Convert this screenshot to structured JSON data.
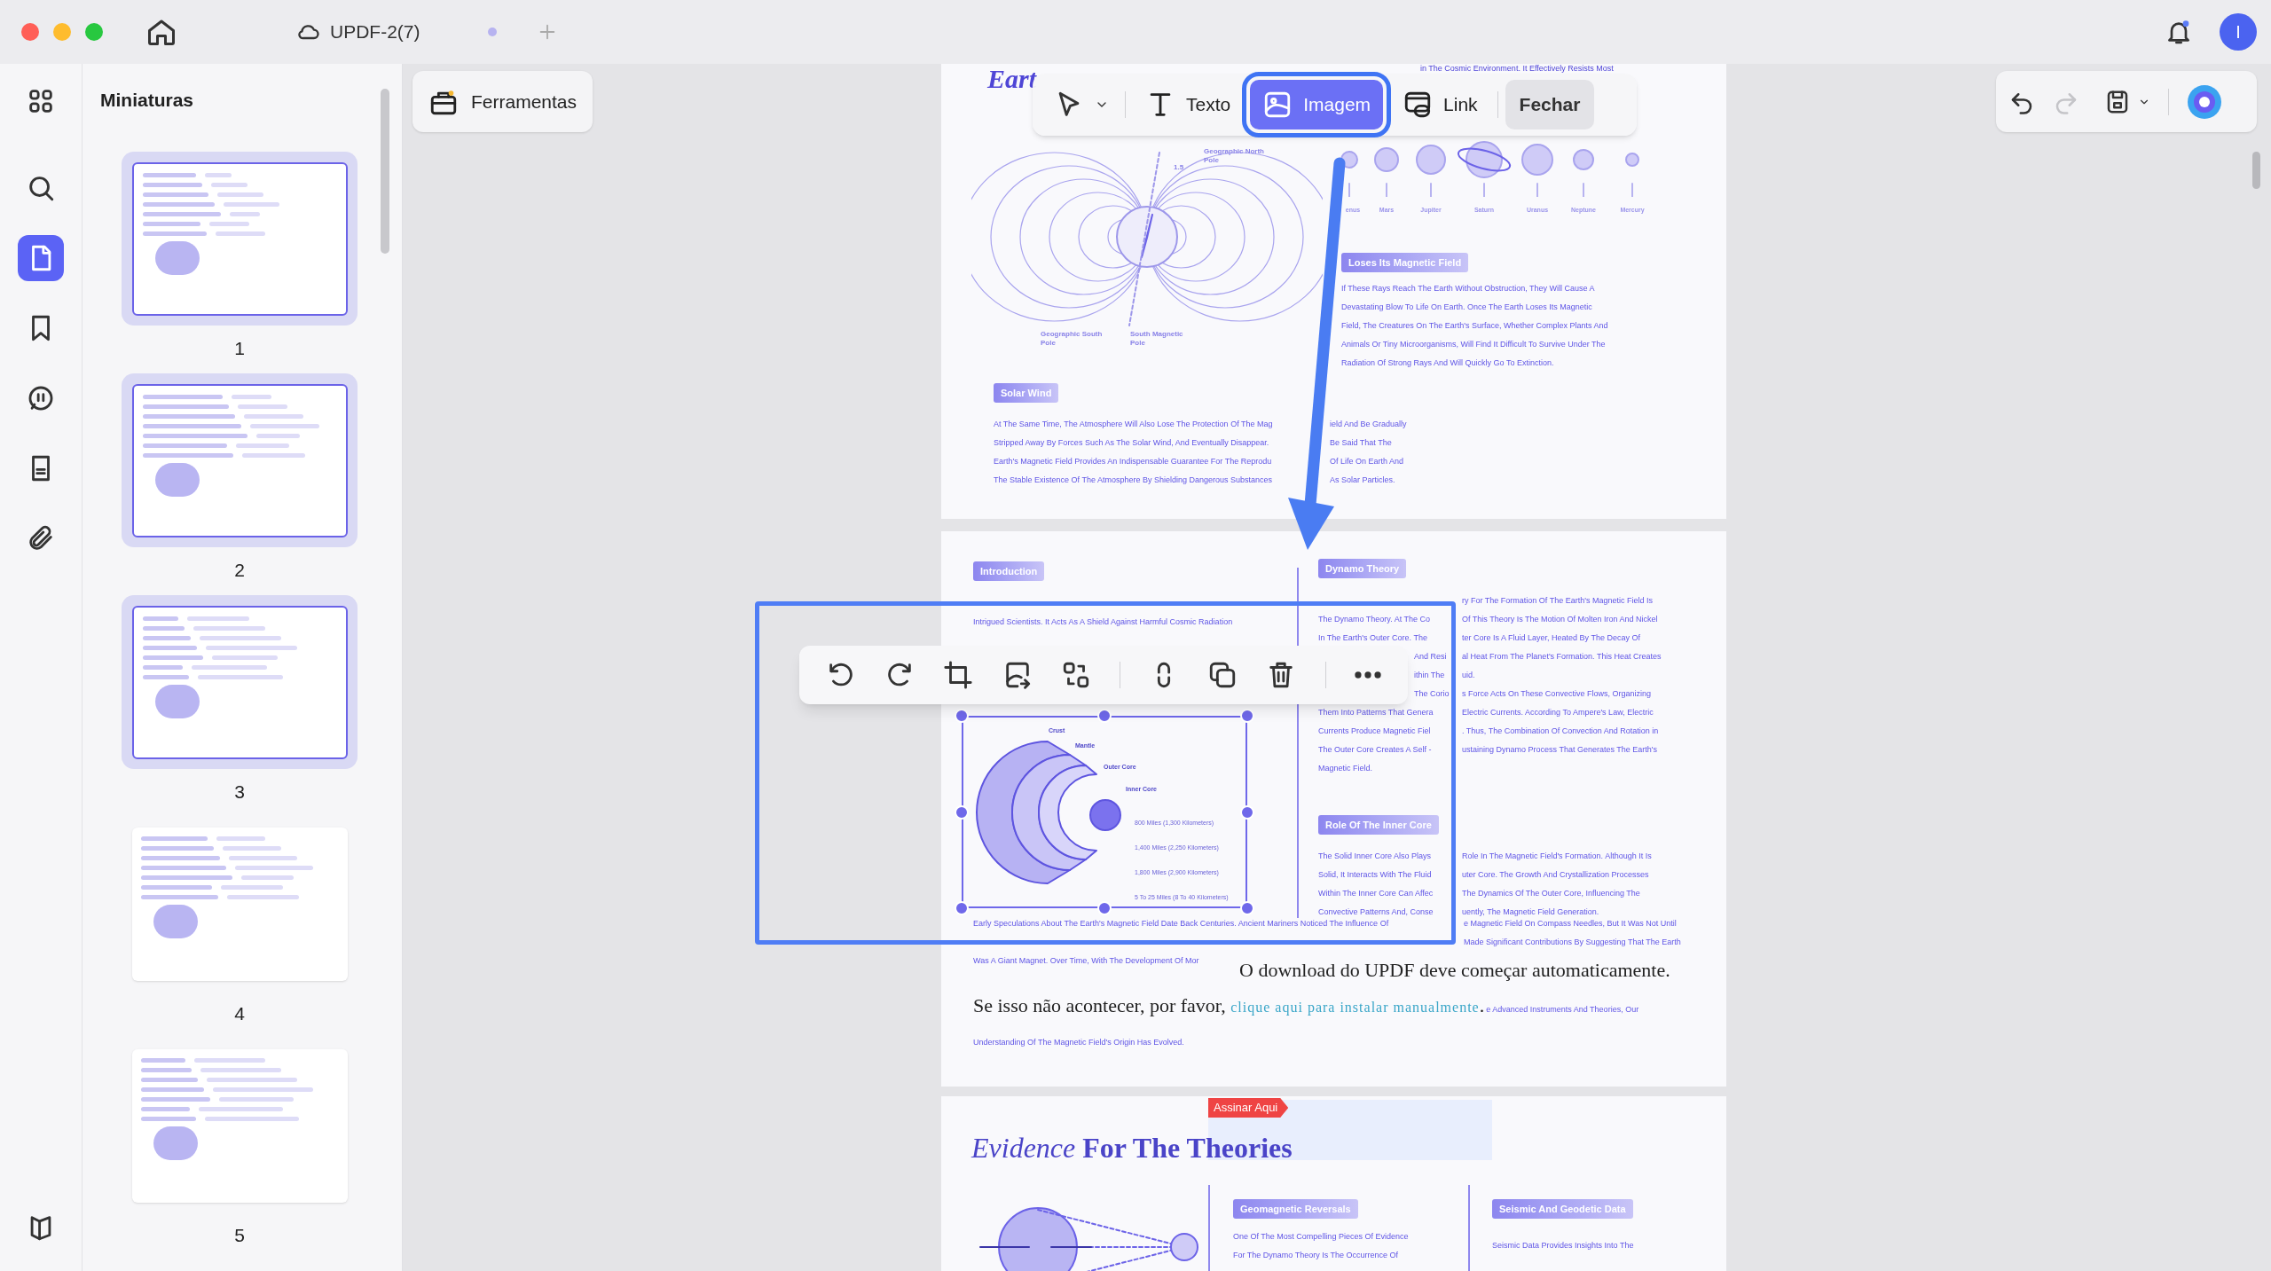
{
  "window": {
    "tab_title": "UPDF-2(7)",
    "avatar": "I"
  },
  "rail": {
    "items": [
      {
        "selected": false
      },
      {
        "selected": false
      },
      {
        "selected": true
      },
      {
        "selected": false
      },
      {
        "selected": false
      },
      {
        "selected": false
      },
      {
        "selected": false
      }
    ]
  },
  "thumbnails": {
    "title": "Miniaturas",
    "pages": [
      {
        "number": "1",
        "selected": true
      },
      {
        "number": "2",
        "selected": true
      },
      {
        "number": "3",
        "selected": true
      },
      {
        "number": "4",
        "selected": false
      },
      {
        "number": "5",
        "selected": false
      }
    ]
  },
  "tools_button": {
    "label": "Ferramentas"
  },
  "edit_toolbar": {
    "tools": [
      {
        "label": "Texto",
        "selected": false
      },
      {
        "label": "Imagem",
        "selected": true
      },
      {
        "label": "Link",
        "selected": false
      }
    ],
    "close": "Fechar"
  },
  "history": {
    "undo": {
      "disabled": false
    },
    "redo": {
      "disabled": true
    }
  },
  "page_1": {
    "title": "Eart",
    "top_text": "in The Cosmic Environment. It Effectively Resists Most",
    "field_labels": [
      "Geographic North Pole",
      "1.5",
      "Geographic South Pole",
      "South Magnetic Pole"
    ],
    "planet_labels": [
      "enus",
      "Mars",
      "Jupiter",
      "Saturn",
      "Uranus",
      "Neptune",
      "Mercury"
    ],
    "magnetic_section": {
      "heading": "Loses Its Magnetic Field",
      "lines": [
        "If These Rays Reach The Earth Without Obstruction, They Will Cause A",
        "Devastating Blow To Life On Earth. Once The Earth Loses Its Magnetic",
        "Field, The Creatures On The Earth's Surface, Whether Complex Plants And",
        "Animals Or Tiny Microorganisms, Will Find It Difficult To Survive Under The",
        "Radiation Of Strong Rays And Will Quickly Go To Extinction."
      ]
    },
    "solar_section": {
      "heading": "Solar Wind",
      "lines": [
        [
          "At The Same Time, The Atmosphere Will Also Lose The Protection Of The Mag",
          "ield And Be Gradually"
        ],
        [
          "Stripped Away By Forces Such As The Solar Wind, And Eventually Disappear.",
          "Be Said That The"
        ],
        [
          "Earth's Magnetic Field Provides An Indispensable Guarantee For The Reprodu",
          "Of Life On Earth And"
        ],
        [
          "The Stable Existence Of The Atmosphere By Shielding Dangerous Substances",
          "As Solar Particles."
        ]
      ]
    }
  },
  "page_2": {
    "intro": {
      "heading": "Introduction",
      "lines": [
        "Intrigued Scientists. It Acts As A Shield Against Harmful Cosmic Radiation"
      ]
    },
    "dynamo": {
      "heading": "Dynamo Theory",
      "lines": [
        {
          "kind": "right_only",
          "parts": [
            "ry For The Formation Of The Earth's Magnetic Field Is"
          ]
        },
        {
          "kind": "plain",
          "parts": [
            "The Dynamo Theory. At The Co",
            "Of This Theory Is The Motion Of Molten Iron And Nickel"
          ]
        },
        {
          "kind": "plain",
          "parts": [
            "In The Earth's Outer Core. The",
            "ter Core Is A Fluid Layer, Heated By The Decay Of"
          ]
        },
        {
          "kind": "under_toolbar",
          "parts": [
            "And Resi",
            "al Heat From The Planet's Formation. This Heat Creates"
          ]
        },
        {
          "kind": "under_toolbar",
          "parts": [
            "ithin The",
            "uid."
          ]
        },
        {
          "kind": "under_toolbar",
          "parts": [
            "The Corio",
            "s Force Acts On These Convective Flows, Organizing"
          ]
        },
        {
          "kind": "plain",
          "parts": [
            "Them Into Patterns That Genera",
            "Electric Currents. According To Ampere's Law, Electric"
          ]
        },
        {
          "kind": "plain",
          "parts": [
            "Currents Produce Magnetic Fiel",
            ". Thus, The Combination Of Convection And Rotation in"
          ]
        },
        {
          "kind": "plain",
          "parts": [
            "The Outer Core Creates A Self -",
            "ustaining Dynamo Process That Generates The Earth's"
          ]
        },
        {
          "kind": "plain",
          "parts": [
            "Magnetic Field."
          ]
        }
      ]
    },
    "inner_core": {
      "heading": "Role Of The Inner Core",
      "lines": [
        {
          "kind": "plain",
          "parts": [
            "The Solid Inner Core Also Plays",
            "Role In The Magnetic Field's Formation. Although It Is"
          ]
        },
        {
          "kind": "plain",
          "parts": [
            "Solid, It Interacts With The Fluid",
            "uter Core. The Growth And Crystallization Processes"
          ]
        },
        {
          "kind": "plain",
          "parts": [
            "Within The Inner Core Can Affec",
            "The Dynamics Of The Outer Core, Influencing The"
          ]
        },
        {
          "kind": "plain",
          "parts": [
            "Convective Patterns And, Conse",
            "uently, The Magnetic Field Generation."
          ]
        }
      ]
    },
    "core_figure": {
      "selected": true,
      "labels": [
        "Crust",
        "Mantle",
        "Outer Core",
        "Inner Core"
      ],
      "distances": [
        "800 Miles (1,300 Kilometers)",
        "1,400 Miles (2,250 Kilometers)",
        "1,800 Miles (2,900 Kilometers)",
        "5 To 25 Miles (8 To 40 Kilometers)"
      ]
    },
    "history_lines": [
      {
        "kind": "wide",
        "parts": [
          "Early Speculations About The Earth's Magnetic Field Date Back Centuries. Ancient Mariners Noticed The Influence Of",
          "e Magnetic Field On Compass Needles, But It Was Not Until"
        ]
      },
      {
        "kind": "wide_right",
        "parts": [
          "Made Significant Contributions By Suggesting That The Earth"
        ]
      },
      {
        "kind": "plain",
        "parts": [
          "Was A Giant Magnet. Over Time, With The Development Of Mor"
        ]
      }
    ],
    "download_notice": {
      "line_1": "O download do UPDF deve começar automaticamente.",
      "line_2": "Se isso não acontecer, por favor,",
      "link": "clique aqui para instalar manualmente",
      "end": "."
    },
    "trailing_text": [
      "e Advanced Instruments And Theories, Our",
      "Understanding Of The Magnetic Field's Origin Has Evolved."
    ]
  },
  "page_3": {
    "sign_tag": "Assinar Aqui",
    "title": "*Evidence* **For The Theories**",
    "columns": [
      {
        "heading": "Geomagnetic Reversals",
        "lines": [
          "One Of The Most Compelling Pieces Of Evidence",
          "For The Dynamo Theory Is The Occurrence Of"
        ]
      },
      {
        "heading": "Seismic And Geodetic Data",
        "lines": [
          "Seismic Data Provides Insights Into The"
        ]
      }
    ]
  }
}
